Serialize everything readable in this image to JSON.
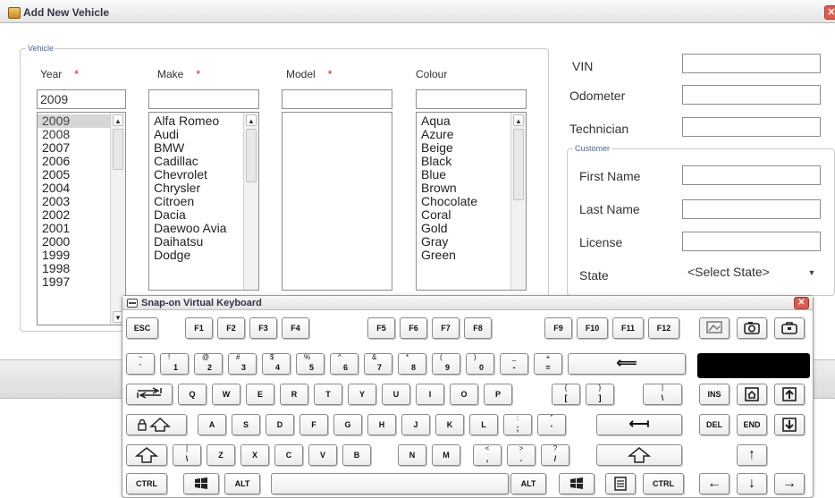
{
  "window": {
    "title": "Add New Vehicle",
    "close_glyph": "✕"
  },
  "vehicle": {
    "legend": "Vehicle",
    "year": {
      "label": "Year",
      "required_mark": "*",
      "value": "2009",
      "list": [
        "2009",
        "2008",
        "2007",
        "2006",
        "2005",
        "2004",
        "2003",
        "2002",
        "2001",
        "2000",
        "1999",
        "1998",
        "1997"
      ],
      "selected": "2009"
    },
    "make": {
      "label": "Make",
      "required_mark": "*",
      "value": "",
      "list": [
        "Alfa Romeo",
        "Audi",
        "BMW",
        "Cadillac",
        "Chevrolet",
        "Chrysler",
        "Citroen",
        "Dacia",
        "Daewoo Avia",
        "Daihatsu",
        "Dodge"
      ]
    },
    "model": {
      "label": "Model",
      "required_mark": "*",
      "value": "",
      "list": []
    },
    "colour": {
      "label": "Colour",
      "value": "",
      "list": [
        "Aqua",
        "Azure",
        "Beige",
        "Black",
        "Blue",
        "Brown",
        "Chocolate",
        "Coral",
        "Gold",
        "Gray",
        "Green"
      ]
    }
  },
  "right_fields": {
    "vin": {
      "label": "VIN",
      "value": ""
    },
    "odometer": {
      "label": "Odometer",
      "value": ""
    },
    "technician": {
      "label": "Technician",
      "value": ""
    }
  },
  "customer": {
    "legend": "Customer",
    "first_name": {
      "label": "First Name",
      "value": ""
    },
    "last_name": {
      "label": "Last Name",
      "value": ""
    },
    "license": {
      "label": "License",
      "value": ""
    },
    "state": {
      "label": "State",
      "value": "<Select State>"
    }
  },
  "keyboard": {
    "title": "Snap-on Virtual Keyboard",
    "close_glyph": "✕",
    "row_fn": [
      "ESC",
      "F1",
      "F2",
      "F3",
      "F4",
      "F5",
      "F6",
      "F7",
      "F8",
      "F9",
      "F10",
      "F11",
      "F12"
    ],
    "row_num": [
      {
        "up": "~",
        "dn": "`"
      },
      {
        "up": "!",
        "dn": "1"
      },
      {
        "up": "@",
        "dn": "2"
      },
      {
        "up": "#",
        "dn": "3"
      },
      {
        "up": "$",
        "dn": "4"
      },
      {
        "up": "%",
        "dn": "5"
      },
      {
        "up": "^",
        "dn": "6"
      },
      {
        "up": "&",
        "dn": "7"
      },
      {
        "up": "*",
        "dn": "8"
      },
      {
        "up": "(",
        "dn": "9"
      },
      {
        "up": ")",
        "dn": "0"
      },
      {
        "up": "_",
        "dn": "-"
      },
      {
        "up": "+",
        "dn": "="
      }
    ],
    "row_q": [
      "Q",
      "W",
      "E",
      "R",
      "T",
      "Y",
      "U",
      "I",
      "O",
      "P"
    ],
    "row_q_sym": [
      {
        "up": "{",
        "dn": "["
      },
      {
        "up": "}",
        "dn": "]"
      },
      {
        "up": "|",
        "dn": "\\"
      }
    ],
    "row_a": [
      "A",
      "S",
      "D",
      "F",
      "G",
      "H",
      "J",
      "K",
      "L"
    ],
    "row_a_sym": [
      {
        "up": ":",
        "dn": ";"
      },
      {
        "up": "\"",
        "dn": "'"
      }
    ],
    "row_z_sym_left": {
      "up": "|",
      "dn": "\\"
    },
    "row_z": [
      "Z",
      "X",
      "C",
      "V",
      "B",
      "N",
      "M"
    ],
    "row_z_sym": [
      {
        "up": "<",
        "dn": ","
      },
      {
        "up": ">",
        "dn": "."
      },
      {
        "up": "?",
        "dn": "/"
      }
    ],
    "ctrl": "CTRL",
    "alt": "ALT",
    "nav": {
      "ins": "INS",
      "del": "DEL",
      "end": "END"
    },
    "arrows": {
      "up": "↑",
      "left": "←",
      "down": "↓",
      "right": "→"
    },
    "backspace_glyph": "⟸",
    "enter_glyph": "⟻"
  }
}
